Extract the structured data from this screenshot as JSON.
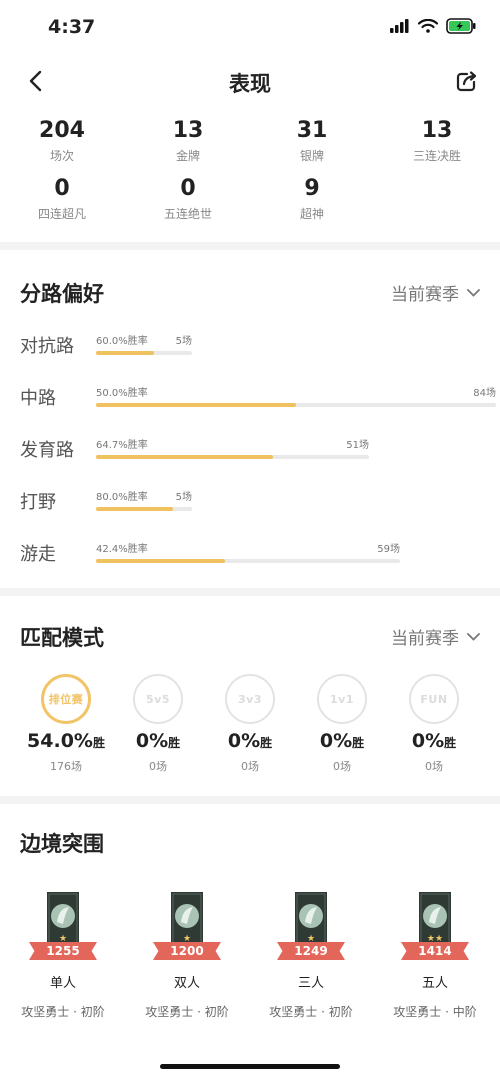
{
  "status_bar": {
    "time": "4:37"
  },
  "nav": {
    "title": "表现"
  },
  "stats": [
    {
      "value": "204",
      "label": "场次"
    },
    {
      "value": "13",
      "label": "金牌"
    },
    {
      "value": "31",
      "label": "银牌"
    },
    {
      "value": "13",
      "label": "三连决胜"
    },
    {
      "value": "0",
      "label": "四连超凡"
    },
    {
      "value": "0",
      "label": "五连绝世"
    },
    {
      "value": "9",
      "label": "超神"
    }
  ],
  "lane_pref": {
    "title": "分路偏好",
    "season": "当前赛季",
    "lanes": [
      {
        "name": "对抗路",
        "rate": "60.0%胜率",
        "count": "5场",
        "win_fraction": 0.6,
        "games": 5
      },
      {
        "name": "中路",
        "rate": "50.0%胜率",
        "count": "84场",
        "win_fraction": 0.5,
        "games": 84
      },
      {
        "name": "发育路",
        "rate": "64.7%胜率",
        "count": "51场",
        "win_fraction": 0.647,
        "games": 51
      },
      {
        "name": "打野",
        "rate": "80.0%胜率",
        "count": "5场",
        "win_fraction": 0.8,
        "games": 5
      },
      {
        "name": "游走",
        "rate": "42.4%胜率",
        "count": "59场",
        "win_fraction": 0.424,
        "games": 59
      }
    ]
  },
  "match_mode": {
    "title": "匹配模式",
    "season": "当前赛季",
    "modes": [
      {
        "badge": "排位赛",
        "rate": "54.0%",
        "suffix": "胜",
        "count": "176场",
        "active": true
      },
      {
        "badge": "5v5",
        "rate": "0%",
        "suffix": "胜",
        "count": "0场",
        "active": false
      },
      {
        "badge": "3v3",
        "rate": "0%",
        "suffix": "胜",
        "count": "0场",
        "active": false
      },
      {
        "badge": "1v1",
        "rate": "0%",
        "suffix": "胜",
        "count": "0场",
        "active": false
      },
      {
        "badge": "FUN",
        "rate": "0%",
        "suffix": "胜",
        "count": "0场",
        "active": false
      }
    ]
  },
  "border_breakout": {
    "title": "边境突围",
    "ranks": [
      {
        "score": "1255",
        "name": "单人",
        "tier": "攻坚勇士 · 初阶",
        "stars": 1
      },
      {
        "score": "1200",
        "name": "双人",
        "tier": "攻坚勇士 · 初阶",
        "stars": 1
      },
      {
        "score": "1249",
        "name": "三人",
        "tier": "攻坚勇士 · 初阶",
        "stars": 1
      },
      {
        "score": "1414",
        "name": "五人",
        "tier": "攻坚勇士 · 中阶",
        "stars": 2
      }
    ]
  },
  "colors": {
    "accent": "#f0c15f",
    "ribbon": "#e2665a",
    "emblem": "#2f3a35"
  }
}
